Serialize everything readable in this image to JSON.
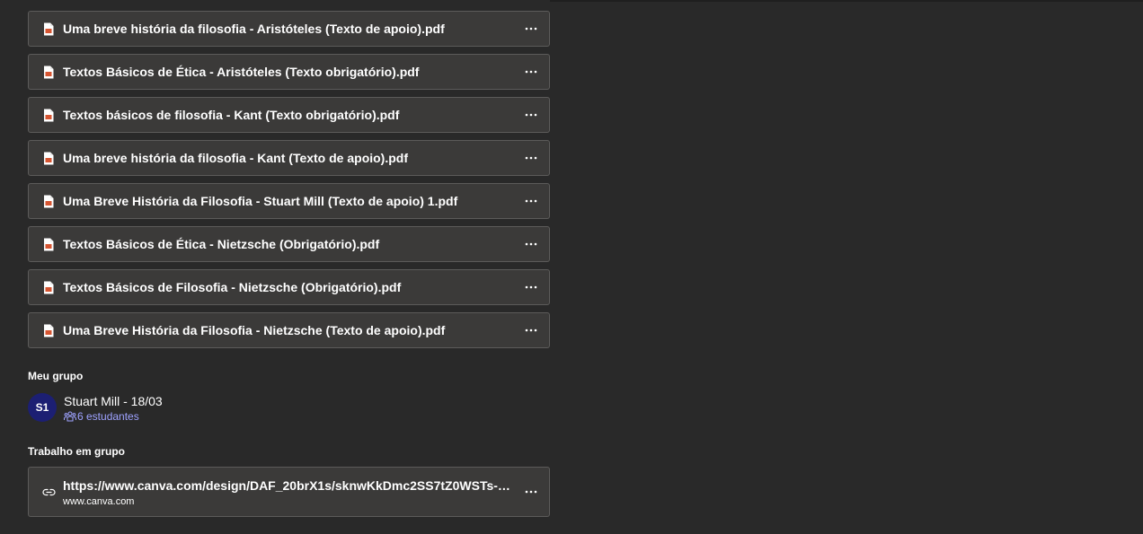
{
  "files": [
    {
      "name": "Uma breve história da filosofia - Aristóteles (Texto de apoio).pdf",
      "icon": "pdf-file-icon",
      "more_icon": "more-options-icon"
    },
    {
      "name": "Textos Básicos de Ética - Aristóteles (Texto obrigatório).pdf",
      "icon": "pdf-file-icon",
      "more_icon": "more-options-icon"
    },
    {
      "name": "Textos básicos de filosofia - Kant (Texto obrigatório).pdf",
      "icon": "pdf-file-icon",
      "more_icon": "more-options-icon"
    },
    {
      "name": "Uma breve história da filosofia - Kant (Texto de apoio).pdf",
      "icon": "pdf-file-icon",
      "more_icon": "more-options-icon"
    },
    {
      "name": "Uma Breve História da Filosofia - Stuart Mill (Texto de apoio) 1.pdf",
      "icon": "pdf-file-icon",
      "more_icon": "more-options-icon"
    },
    {
      "name": "Textos Básicos de Ética - Nietzsche (Obrigatório).pdf",
      "icon": "pdf-file-icon",
      "more_icon": "more-options-icon"
    },
    {
      "name": "Textos Básicos de Filosofia - Nietzsche (Obrigatório).pdf",
      "icon": "pdf-file-icon",
      "more_icon": "more-options-icon"
    },
    {
      "name": "Uma Breve História da Filosofia - Nietzsche (Texto de apoio).pdf",
      "icon": "pdf-file-icon",
      "more_icon": "more-options-icon"
    }
  ],
  "my_group": {
    "label": "Meu grupo",
    "avatar_initials": "S1",
    "name": "Stuart Mill - 18/03",
    "students": "6 estudantes",
    "students_icon": "people-icon"
  },
  "group_work": {
    "label": "Trabalho em grupo",
    "link_icon": "link-icon",
    "url": "https://www.canva.com/design/DAF_20brX1s/sknwKkDmc2SS7tZ0WSTs-A/ed…",
    "domain": "www.canva.com"
  },
  "colors": {
    "background": "#292929",
    "card": "#3b3a39",
    "card_border": "#5c5b5a",
    "pdf_red": "#d65532",
    "accent": "#9ea2ff",
    "avatar": "#1c1f73"
  }
}
